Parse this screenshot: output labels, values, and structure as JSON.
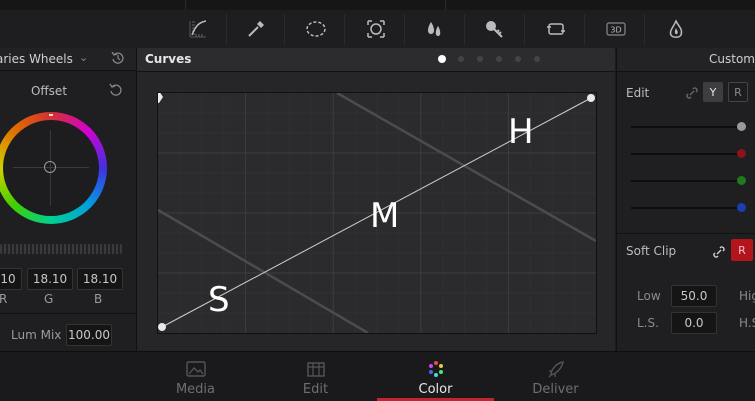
{
  "toolbar": {
    "tools": [
      {
        "icon": "curves-icon"
      },
      {
        "icon": "eyedropper-icon"
      },
      {
        "icon": "window-icon"
      },
      {
        "icon": "tracker-icon"
      },
      {
        "icon": "blur-icon"
      },
      {
        "icon": "key-icon"
      },
      {
        "icon": "sizing-icon"
      },
      {
        "icon": "3d-icon",
        "text": "3D"
      },
      {
        "icon": "magic-icon"
      }
    ]
  },
  "left_panel": {
    "title": "aries Wheels",
    "wheel_label": "Offset",
    "values": [
      {
        "value": "10",
        "label": "R"
      },
      {
        "value": "18.10",
        "label": "G"
      },
      {
        "value": "18.10",
        "label": "B"
      }
    ],
    "lum_mix_label": "Lum Mix",
    "lum_mix_value": "100.00"
  },
  "curves_panel": {
    "title": "Curves",
    "page_dots": 6,
    "active_dot": 0,
    "labels": {
      "shadows": "S",
      "mids": "M",
      "highlights": "H"
    }
  },
  "right_panel": {
    "title": "Custom",
    "edit_label": "Edit",
    "channel_y": "Y",
    "channel_r": "R",
    "slider_colors": [
      "#9a9a9a",
      "#8a1418",
      "#1f7a1f",
      "#1a3fb0"
    ],
    "soft_clip_label": "Soft Clip",
    "soft_clip_btn": "R",
    "low_label": "Low",
    "low_value": "50.0",
    "high_label": "Hig",
    "ls_label": "L.S.",
    "ls_value": "0.0",
    "hs_label": "H.S"
  },
  "pages": [
    {
      "label": "Media",
      "icon": "media-icon",
      "active": false
    },
    {
      "label": "Edit",
      "icon": "edit-icon",
      "active": false
    },
    {
      "label": "Color",
      "icon": "color-icon",
      "active": true
    },
    {
      "label": "Deliver",
      "icon": "deliver-icon",
      "active": false
    }
  ],
  "colors": {
    "accent": "#c0262b",
    "panel": "#262628"
  }
}
